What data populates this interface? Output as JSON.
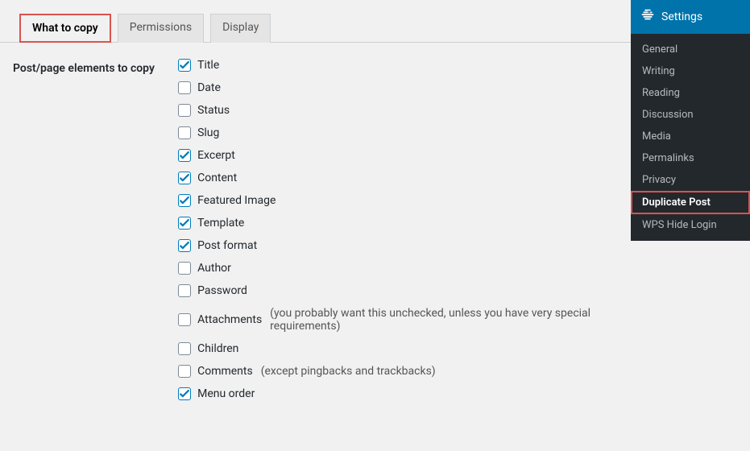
{
  "tabs": [
    {
      "label": "What to copy",
      "active": true
    },
    {
      "label": "Permissions",
      "active": false
    },
    {
      "label": "Display",
      "active": false
    }
  ],
  "section_label": "Post/page elements to copy",
  "elements": [
    {
      "label": "Title",
      "checked": true,
      "hint": ""
    },
    {
      "label": "Date",
      "checked": false,
      "hint": ""
    },
    {
      "label": "Status",
      "checked": false,
      "hint": ""
    },
    {
      "label": "Slug",
      "checked": false,
      "hint": ""
    },
    {
      "label": "Excerpt",
      "checked": true,
      "hint": ""
    },
    {
      "label": "Content",
      "checked": true,
      "hint": ""
    },
    {
      "label": "Featured Image",
      "checked": true,
      "hint": ""
    },
    {
      "label": "Template",
      "checked": true,
      "hint": ""
    },
    {
      "label": "Post format",
      "checked": true,
      "hint": ""
    },
    {
      "label": "Author",
      "checked": false,
      "hint": ""
    },
    {
      "label": "Password",
      "checked": false,
      "hint": ""
    },
    {
      "label": "Attachments",
      "checked": false,
      "hint": "(you probably want this unchecked, unless you have very special requirements)"
    },
    {
      "label": "Children",
      "checked": false,
      "hint": ""
    },
    {
      "label": "Comments",
      "checked": false,
      "hint": "(except pingbacks and trackbacks)"
    },
    {
      "label": "Menu order",
      "checked": true,
      "hint": ""
    }
  ],
  "sidebar": {
    "title": "Settings",
    "items": [
      {
        "label": "General",
        "active": false
      },
      {
        "label": "Writing",
        "active": false
      },
      {
        "label": "Reading",
        "active": false
      },
      {
        "label": "Discussion",
        "active": false
      },
      {
        "label": "Media",
        "active": false
      },
      {
        "label": "Permalinks",
        "active": false
      },
      {
        "label": "Privacy",
        "active": false
      },
      {
        "label": "Duplicate Post",
        "active": true
      },
      {
        "label": "WPS Hide Login",
        "active": false
      }
    ]
  }
}
